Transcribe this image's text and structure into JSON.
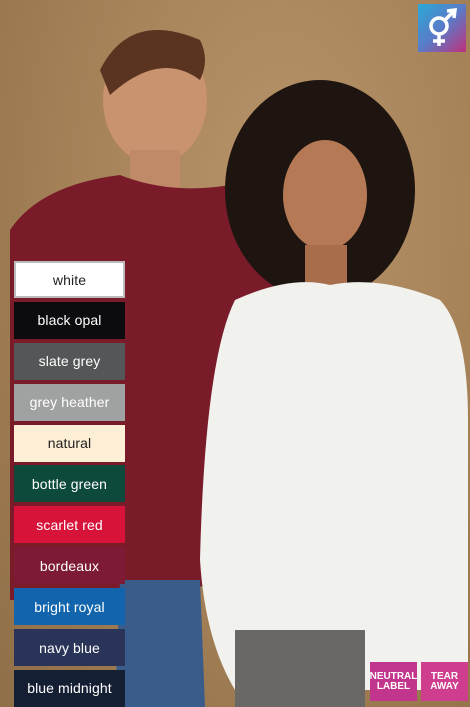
{
  "colors": {
    "options": [
      {
        "label": "white",
        "bg": "#ffffff",
        "light": true,
        "white": true
      },
      {
        "label": "black opal",
        "bg": "#0c0c0e",
        "light": false
      },
      {
        "label": "slate grey",
        "bg": "#545657",
        "light": false
      },
      {
        "label": "grey heather",
        "bg": "#a0a2a1",
        "light": false
      },
      {
        "label": "natural",
        "bg": "#fcefd5",
        "light": true
      },
      {
        "label": "bottle green",
        "bg": "#0e4a3c",
        "light": false
      },
      {
        "label": "scarlet red",
        "bg": "#d7133a",
        "light": false
      },
      {
        "label": "bordeaux",
        "bg": "#7d1a35",
        "light": false
      },
      {
        "label": "bright royal",
        "bg": "#1265ad",
        "light": false
      },
      {
        "label": "navy blue",
        "bg": "#293458",
        "light": false
      },
      {
        "label": "blue midnight",
        "bg": "#141f33",
        "light": false
      }
    ]
  },
  "badges": {
    "unisex_icon": "unisex-gender-icon",
    "neutral_label": {
      "line1": "NEUTRAL",
      "line2": "LABEL"
    },
    "tear_away": {
      "line1": "TEAR",
      "line2": "AWAY"
    }
  }
}
